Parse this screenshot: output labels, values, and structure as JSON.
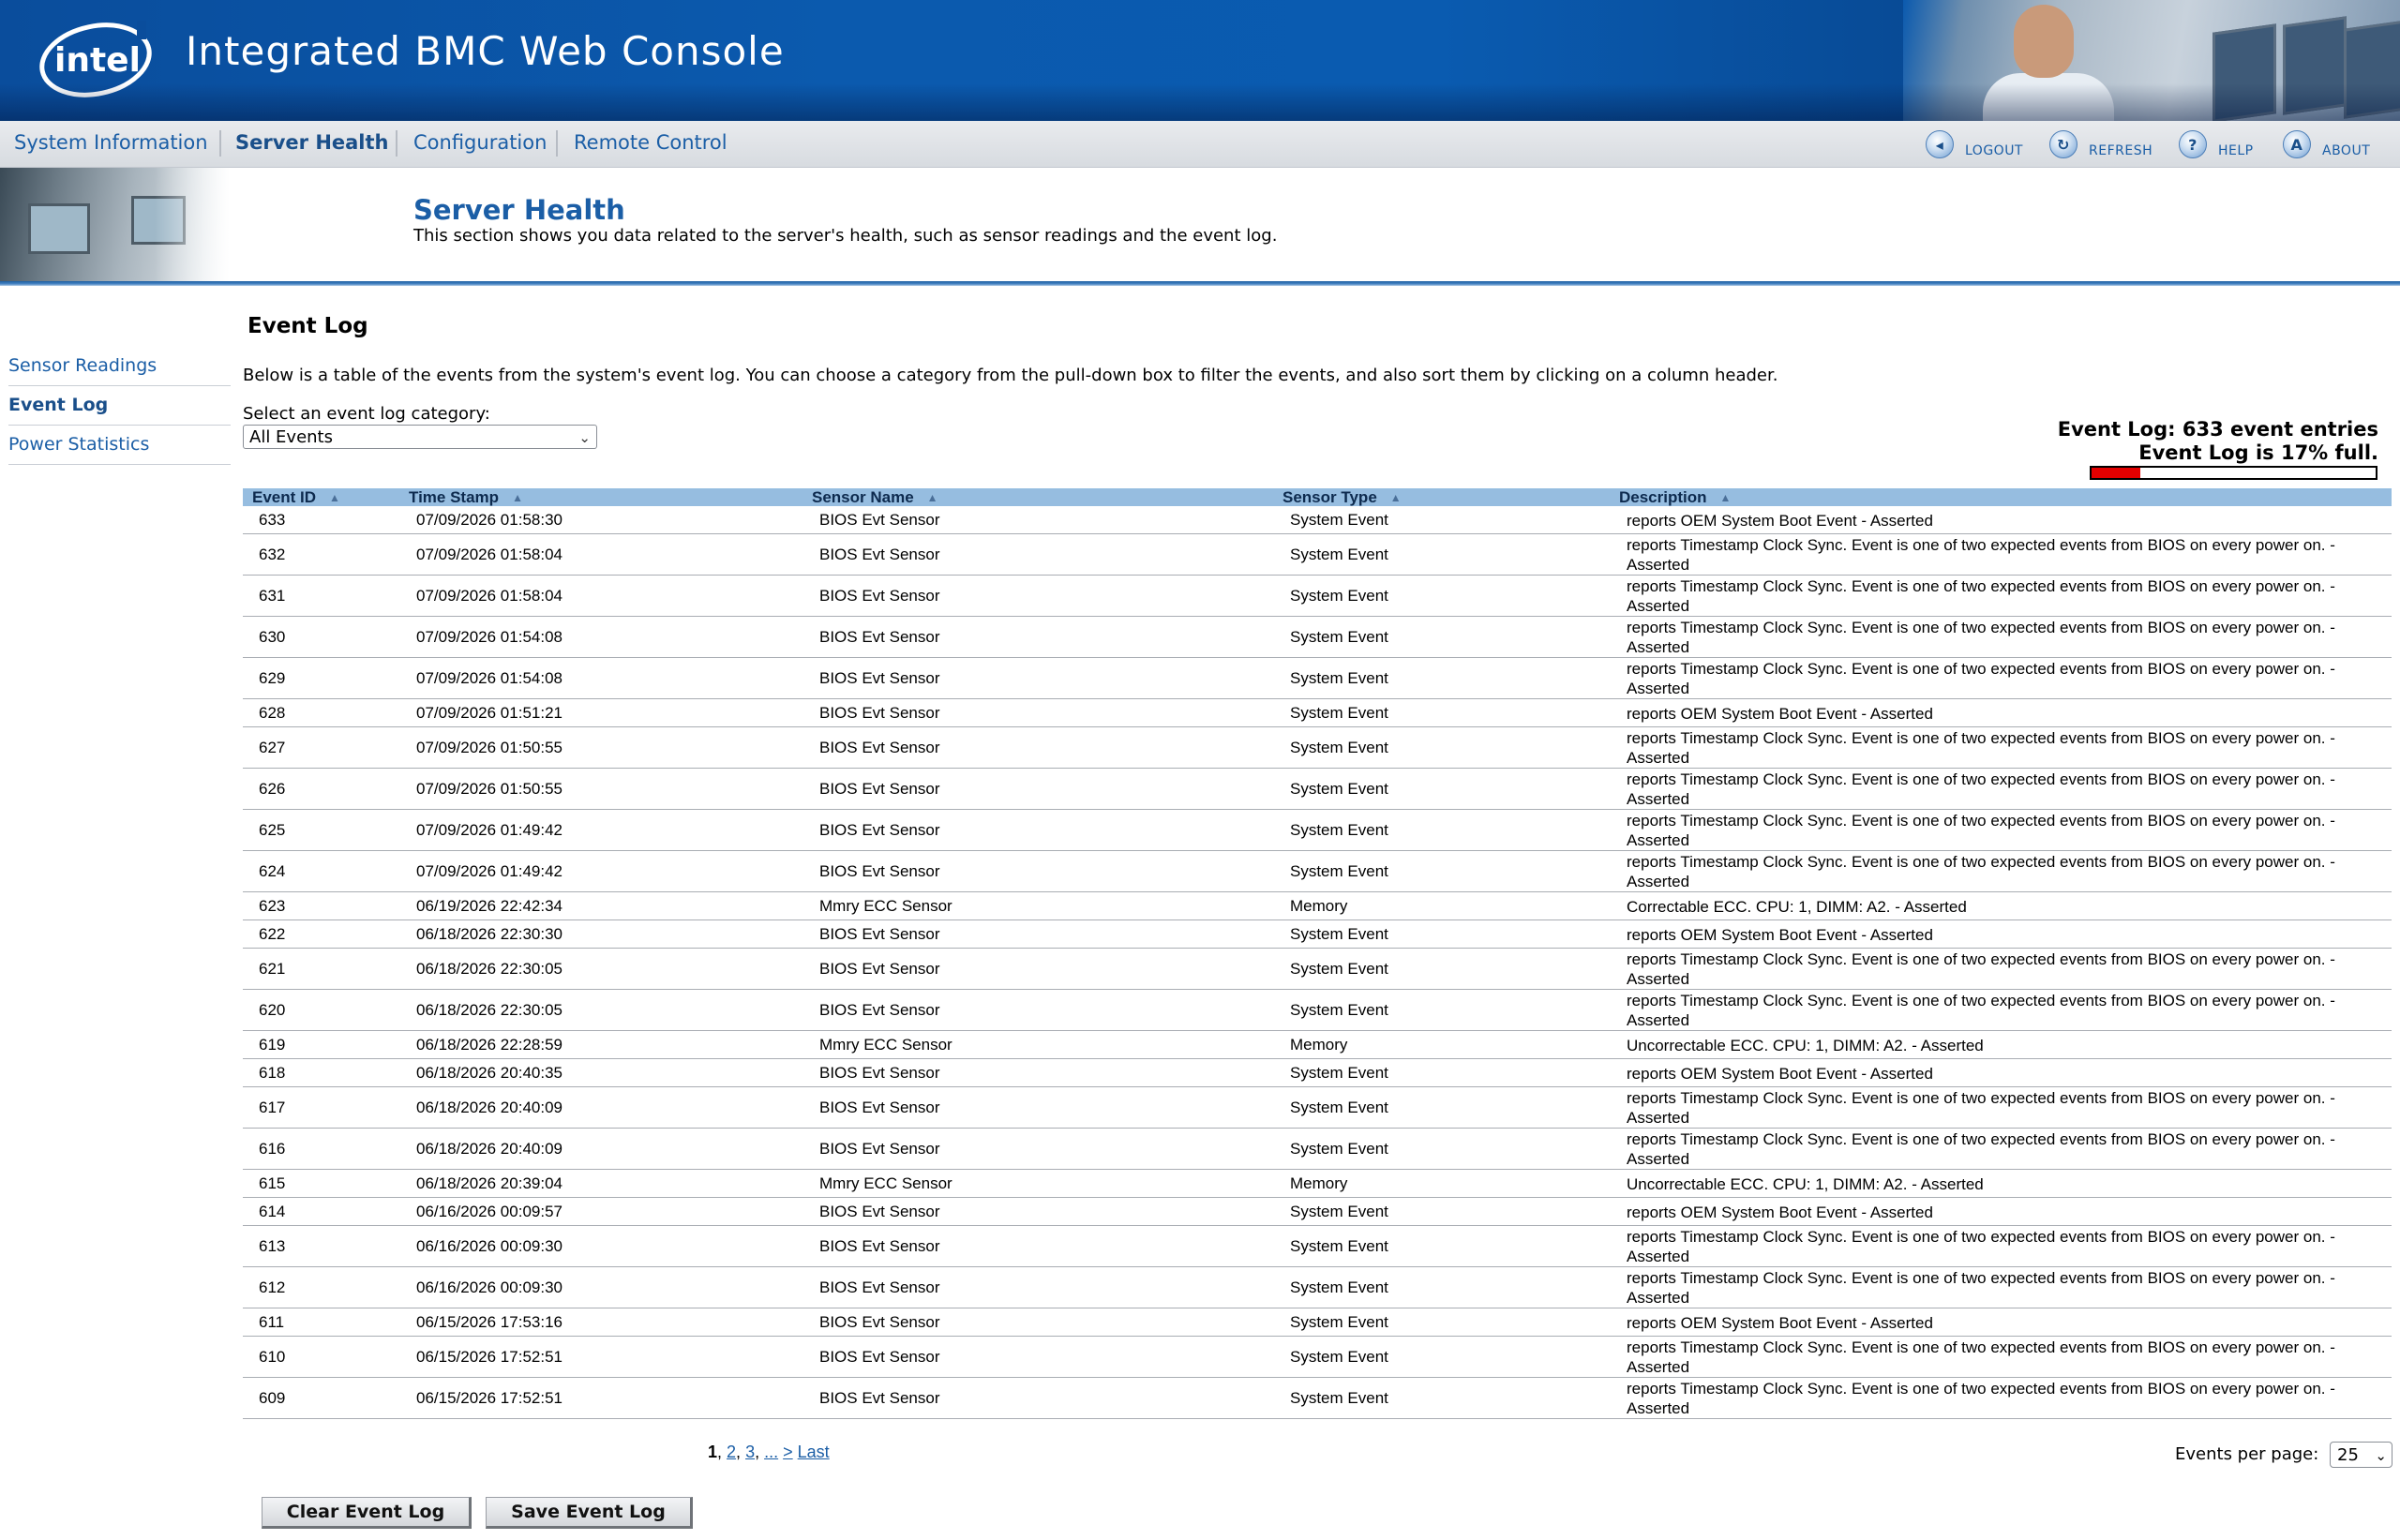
{
  "header": {
    "logo_text": "intel",
    "app_title": "Integrated BMC Web Console"
  },
  "nav": {
    "tabs": [
      {
        "label": "System Information",
        "active": false
      },
      {
        "label": "Server Health",
        "active": true
      },
      {
        "label": "Configuration",
        "active": false
      },
      {
        "label": "Remote Control",
        "active": false
      }
    ],
    "tools": [
      {
        "label": "LOGOUT",
        "icon": "logout-icon",
        "glyph": "◂"
      },
      {
        "label": "REFRESH",
        "icon": "refresh-icon",
        "glyph": "↻"
      },
      {
        "label": "HELP",
        "icon": "help-icon",
        "glyph": "?"
      },
      {
        "label": "ABOUT",
        "icon": "about-icon",
        "glyph": "A"
      }
    ]
  },
  "section": {
    "title": "Server Health",
    "description": "This section shows you data related to the server's health, such as sensor readings and the event log."
  },
  "sidebar": {
    "items": [
      {
        "label": "Sensor Readings",
        "active": false
      },
      {
        "label": "Event Log",
        "active": true
      },
      {
        "label": "Power Statistics",
        "active": false
      }
    ]
  },
  "main": {
    "title": "Event Log",
    "intro": "Below is a table of the events from the system's event log. You can choose a category from the pull-down box to filter the events, and also sort them by clicking on a column header.",
    "category_label": "Select an event log category:",
    "category_value": "All Events",
    "log_count": "Event Log: 633 event entries",
    "log_full": "Event Log is 17% full.",
    "log_fill_fraction": 0.17,
    "accent_color": "#e30000"
  },
  "table": {
    "columns": [
      "Event ID",
      "Time Stamp",
      "Sensor Name",
      "Sensor Type",
      "Description"
    ],
    "rows": [
      {
        "id": "633",
        "time": "07/09/2026 01:58:30",
        "sensor": "BIOS Evt Sensor",
        "type": "System Event",
        "desc": "reports OEM System Boot Event - Asserted"
      },
      {
        "id": "632",
        "time": "07/09/2026 01:58:04",
        "sensor": "BIOS Evt Sensor",
        "type": "System Event",
        "desc": "reports Timestamp Clock Sync. Event is one of two expected events from BIOS on every power on. - Asserted"
      },
      {
        "id": "631",
        "time": "07/09/2026 01:58:04",
        "sensor": "BIOS Evt Sensor",
        "type": "System Event",
        "desc": "reports Timestamp Clock Sync. Event is one of two expected events from BIOS on every power on. - Asserted"
      },
      {
        "id": "630",
        "time": "07/09/2026 01:54:08",
        "sensor": "BIOS Evt Sensor",
        "type": "System Event",
        "desc": "reports Timestamp Clock Sync. Event is one of two expected events from BIOS on every power on. - Asserted"
      },
      {
        "id": "629",
        "time": "07/09/2026 01:54:08",
        "sensor": "BIOS Evt Sensor",
        "type": "System Event",
        "desc": "reports Timestamp Clock Sync. Event is one of two expected events from BIOS on every power on. - Asserted"
      },
      {
        "id": "628",
        "time": "07/09/2026 01:51:21",
        "sensor": "BIOS Evt Sensor",
        "type": "System Event",
        "desc": "reports OEM System Boot Event - Asserted"
      },
      {
        "id": "627",
        "time": "07/09/2026 01:50:55",
        "sensor": "BIOS Evt Sensor",
        "type": "System Event",
        "desc": "reports Timestamp Clock Sync. Event is one of two expected events from BIOS on every power on. - Asserted"
      },
      {
        "id": "626",
        "time": "07/09/2026 01:50:55",
        "sensor": "BIOS Evt Sensor",
        "type": "System Event",
        "desc": "reports Timestamp Clock Sync. Event is one of two expected events from BIOS on every power on. - Asserted"
      },
      {
        "id": "625",
        "time": "07/09/2026 01:49:42",
        "sensor": "BIOS Evt Sensor",
        "type": "System Event",
        "desc": "reports Timestamp Clock Sync. Event is one of two expected events from BIOS on every power on. - Asserted"
      },
      {
        "id": "624",
        "time": "07/09/2026 01:49:42",
        "sensor": "BIOS Evt Sensor",
        "type": "System Event",
        "desc": "reports Timestamp Clock Sync. Event is one of two expected events from BIOS on every power on. - Asserted"
      },
      {
        "id": "623",
        "time": "06/19/2026 22:42:34",
        "sensor": "Mmry ECC Sensor",
        "type": "Memory",
        "desc": "Correctable ECC. CPU: 1, DIMM: A2. - Asserted"
      },
      {
        "id": "622",
        "time": "06/18/2026 22:30:30",
        "sensor": "BIOS Evt Sensor",
        "type": "System Event",
        "desc": "reports OEM System Boot Event - Asserted"
      },
      {
        "id": "621",
        "time": "06/18/2026 22:30:05",
        "sensor": "BIOS Evt Sensor",
        "type": "System Event",
        "desc": "reports Timestamp Clock Sync. Event is one of two expected events from BIOS on every power on. - Asserted"
      },
      {
        "id": "620",
        "time": "06/18/2026 22:30:05",
        "sensor": "BIOS Evt Sensor",
        "type": "System Event",
        "desc": "reports Timestamp Clock Sync. Event is one of two expected events from BIOS on every power on. - Asserted"
      },
      {
        "id": "619",
        "time": "06/18/2026 22:28:59",
        "sensor": "Mmry ECC Sensor",
        "type": "Memory",
        "desc": "Uncorrectable ECC. CPU: 1, DIMM: A2. - Asserted"
      },
      {
        "id": "618",
        "time": "06/18/2026 20:40:35",
        "sensor": "BIOS Evt Sensor",
        "type": "System Event",
        "desc": "reports OEM System Boot Event - Asserted"
      },
      {
        "id": "617",
        "time": "06/18/2026 20:40:09",
        "sensor": "BIOS Evt Sensor",
        "type": "System Event",
        "desc": "reports Timestamp Clock Sync. Event is one of two expected events from BIOS on every power on. - Asserted"
      },
      {
        "id": "616",
        "time": "06/18/2026 20:40:09",
        "sensor": "BIOS Evt Sensor",
        "type": "System Event",
        "desc": "reports Timestamp Clock Sync. Event is one of two expected events from BIOS on every power on. - Asserted"
      },
      {
        "id": "615",
        "time": "06/18/2026 20:39:04",
        "sensor": "Mmry ECC Sensor",
        "type": "Memory",
        "desc": "Uncorrectable ECC. CPU: 1, DIMM: A2. - Asserted"
      },
      {
        "id": "614",
        "time": "06/16/2026 00:09:57",
        "sensor": "BIOS Evt Sensor",
        "type": "System Event",
        "desc": "reports OEM System Boot Event - Asserted"
      },
      {
        "id": "613",
        "time": "06/16/2026 00:09:30",
        "sensor": "BIOS Evt Sensor",
        "type": "System Event",
        "desc": "reports Timestamp Clock Sync. Event is one of two expected events from BIOS on every power on. - Asserted"
      },
      {
        "id": "612",
        "time": "06/16/2026 00:09:30",
        "sensor": "BIOS Evt Sensor",
        "type": "System Event",
        "desc": "reports Timestamp Clock Sync. Event is one of two expected events from BIOS on every power on. - Asserted"
      },
      {
        "id": "611",
        "time": "06/15/2026 17:53:16",
        "sensor": "BIOS Evt Sensor",
        "type": "System Event",
        "desc": "reports OEM System Boot Event - Asserted"
      },
      {
        "id": "610",
        "time": "06/15/2026 17:52:51",
        "sensor": "BIOS Evt Sensor",
        "type": "System Event",
        "desc": "reports Timestamp Clock Sync. Event is one of two expected events from BIOS on every power on. - Asserted"
      },
      {
        "id": "609",
        "time": "06/15/2026 17:52:51",
        "sensor": "BIOS Evt Sensor",
        "type": "System Event",
        "desc": "reports Timestamp Clock Sync. Event is one of two expected events from BIOS on every power on. - Asserted"
      }
    ]
  },
  "pager": {
    "current": "1",
    "pages": [
      "2",
      "3",
      "..."
    ],
    "next": ">",
    "last": "Last",
    "per_page_label": "Events per page:",
    "per_page_value": "25"
  },
  "buttons": {
    "clear": "Clear Event Log",
    "save": "Save Event Log"
  }
}
